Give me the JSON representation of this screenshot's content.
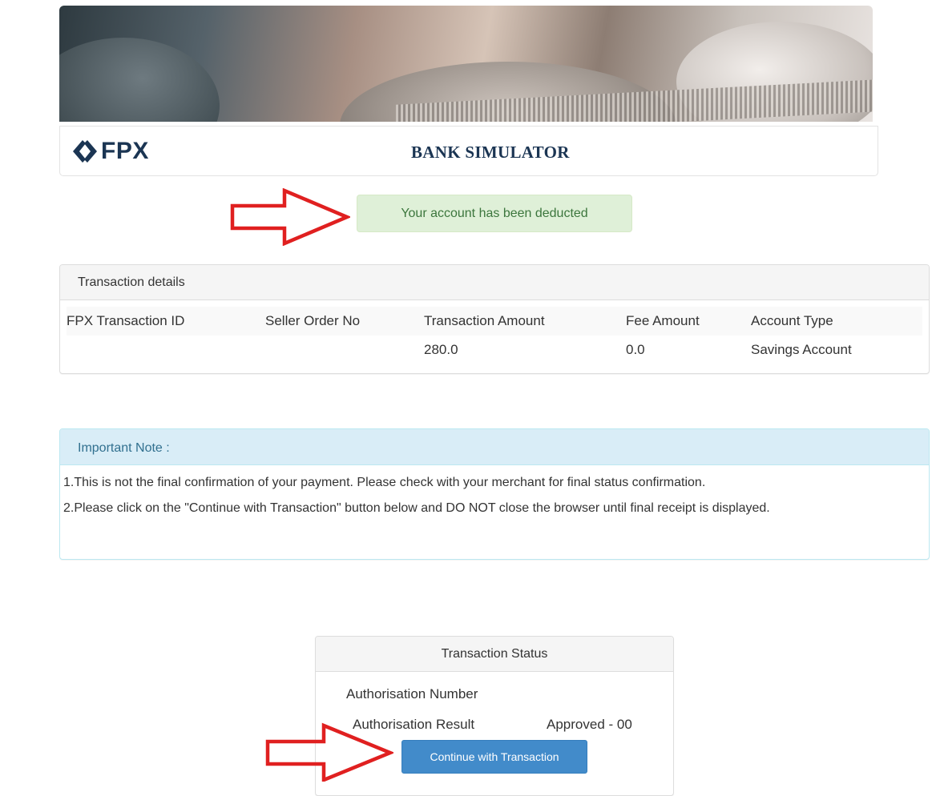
{
  "header": {
    "logo_text": "FPX",
    "title": "BANK SIMULATOR"
  },
  "alert": {
    "message": "Your account has been deducted",
    "color": "#3c763d"
  },
  "transaction": {
    "heading": "Transaction details",
    "columns": [
      "FPX Transaction ID",
      "Seller Order No",
      "Transaction Amount",
      "Fee Amount",
      "Account Type"
    ],
    "row": [
      "",
      "",
      "280.0",
      "0.0",
      "Savings Account"
    ]
  },
  "note": {
    "heading": "Important Note :",
    "items": [
      "1.This is not the final confirmation of your payment. Please check with your merchant for final status confirmation.",
      "2.Please click on the \"Continue with Transaction\" button below and DO NOT close the browser until final receipt is displayed."
    ]
  },
  "status": {
    "heading": "Transaction Status",
    "auth_number_label": "Authorisation Number",
    "auth_number_value": "",
    "auth_result_label": "Authorisation Result",
    "auth_result_value": "Approved - 00",
    "continue_button": "Continue with Transaction"
  },
  "icons": {
    "arrow": "red-outline-arrow-icon",
    "logo": "fpx-logo"
  },
  "colors": {
    "primary_button": "#428bca",
    "annotation_arrow": "#e02020",
    "brand": "#1b3553"
  }
}
